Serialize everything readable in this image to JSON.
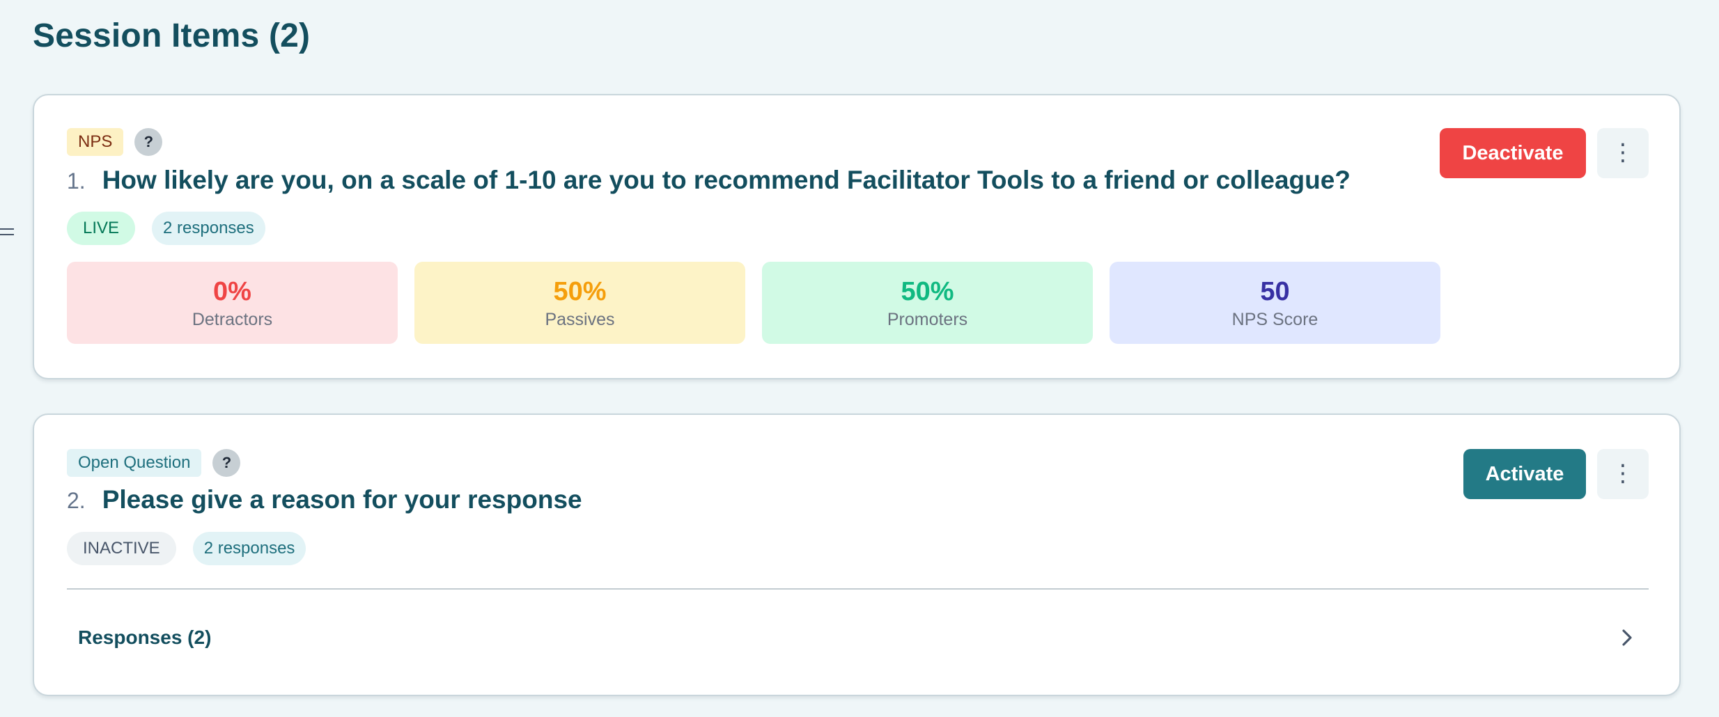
{
  "page": {
    "title": "Session Items (2)"
  },
  "items": [
    {
      "type_label": "NPS",
      "help_symbol": "?",
      "number": "1.",
      "question": "How likely are you, on a scale of 1-10 are you to recommend Facilitator Tools to a friend or colleague?",
      "status": "LIVE",
      "responses_badge": "2 responses",
      "action_label": "Deactivate",
      "more_symbol": "⋮",
      "stats": [
        {
          "value": "0%",
          "label": "Detractors",
          "color": "#ef4444"
        },
        {
          "value": "50%",
          "label": "Passives",
          "color": "#f59e0b"
        },
        {
          "value": "50%",
          "label": "Promoters",
          "color": "#10b981"
        },
        {
          "value": "50",
          "label": "NPS Score",
          "color": "#3730a3"
        }
      ]
    },
    {
      "type_label": "Open Question",
      "help_symbol": "?",
      "number": "2.",
      "question": "Please give a reason for your response",
      "status": "INACTIVE",
      "responses_badge": "2 responses",
      "action_label": "Activate",
      "more_symbol": "⋮",
      "responses_section_label": "Responses (2)"
    }
  ],
  "colors": {
    "primary": "#237a86",
    "danger": "#ef4444",
    "heading": "#134e5e",
    "background": "#eff6f8"
  },
  "icons": {
    "drag_handle": "drag-handle-icon",
    "help": "question-mark-icon",
    "more": "vertical-ellipsis-icon",
    "expand": "chevron-right-icon"
  }
}
